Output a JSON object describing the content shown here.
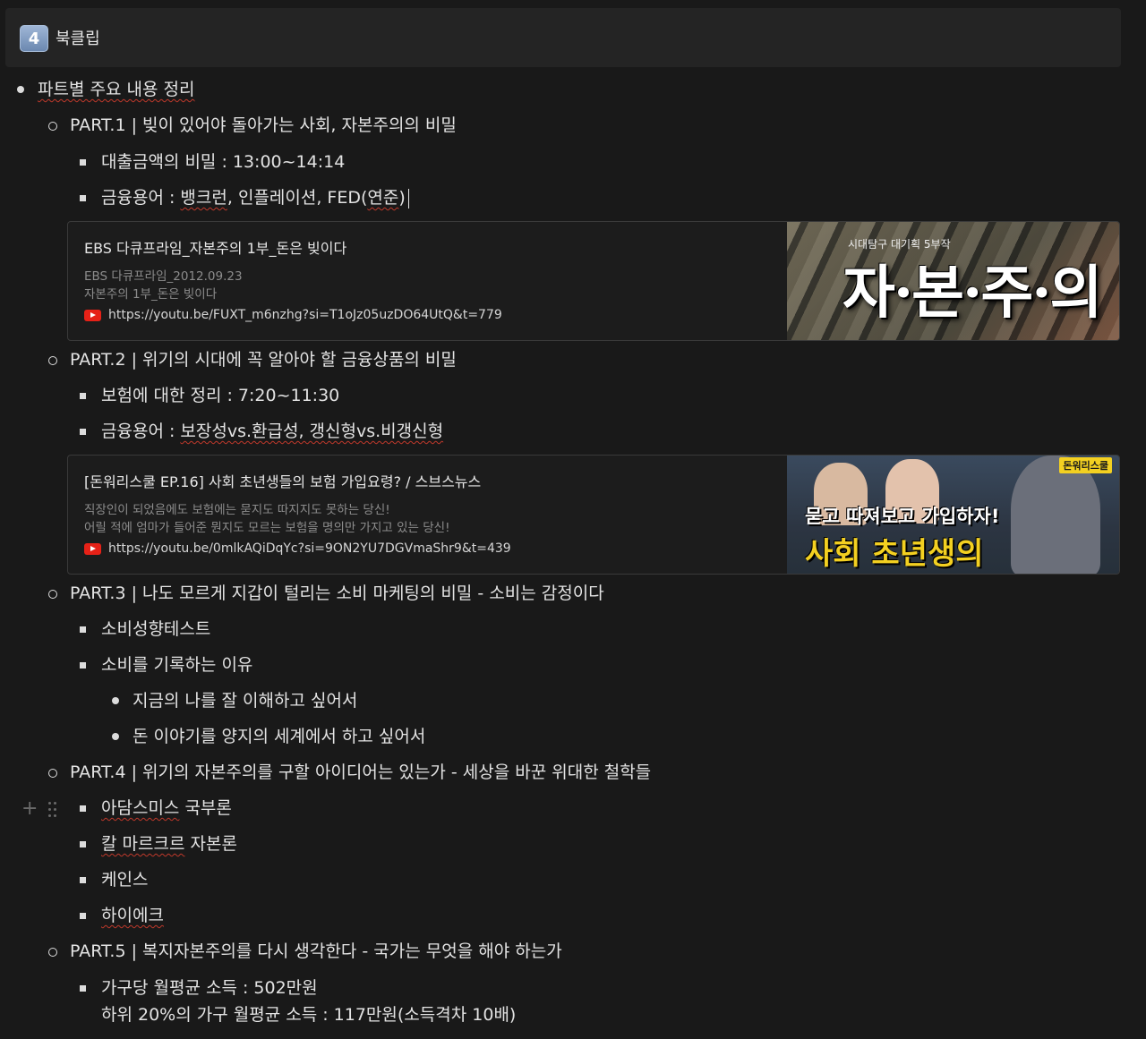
{
  "callout": {
    "badge": "4",
    "title": "북클립"
  },
  "lines": {
    "l1": "파트별 주요 내용 정리",
    "p1": "PART.1 | 빚이 있어야 돌아가는 사회, 자본주의의 비밀",
    "p1a": "대출금액의 비밀 : 13:00~14:14",
    "p1b_prefix": "금융용어 : ",
    "p1b_w1": "뱅크런",
    "p1b_rest": ", 인플레이션, FED(",
    "p1b_w2": "연준",
    "p1b_end": ")",
    "p2": "PART.2 | 위기의 시대에 꼭 알아야 할 금융상품의 비밀",
    "p2a": "보험에 대한 정리 : 7:20~11:30",
    "p2b_prefix": "금융용어 : ",
    "p2b_w": "보장성vs.환급성, 갱신형vs.비갱신형",
    "p3": "PART.3 | 나도 모르게 지갑이 털리는 소비 마케팅의 비밀 - 소비는 감정이다",
    "p3a": "소비성향테스트",
    "p3b": "소비를 기록하는 이유",
    "p3b1": "지금의 나를 잘 이해하고 싶어서",
    "p3b2": "돈 이야기를 양지의 세계에서 하고 싶어서",
    "p4": "PART.4 | 위기의 자본주의를 구할 아이디어는 있는가 - 세상을 바꾼 위대한 철학들",
    "p4a_w": "아담스미스",
    "p4a_rest": " 국부론",
    "p4b_w": "칼 마르크르",
    "p4b_rest": " 자본론",
    "p4c": "케인스",
    "p4d": "하이에크",
    "p5": "PART.5 | 복지자본주의를 다시 생각한다 - 국가는 무엇을 해야 하는가",
    "p5a": "가구당 월평균 소득 : 502만원",
    "p5b": "하위 20%의 가구 월평균 소득 : 117만원(소득격차 10배)"
  },
  "bookmark1": {
    "title": "EBS 다큐프라임_자본주의 1부_돈은 빚이다",
    "desc1": "EBS 다큐프라임_2012.09.23",
    "desc2": "자본주의 1부_돈은 빚이다",
    "url": "https://youtu.be/FUXT_m6nzhg?si=T1oJz05uzDO64UtQ&t=779",
    "thumb_small": "시대탐구 대기획 5부작",
    "thumb_big": "자·본·주·의"
  },
  "bookmark2": {
    "title": "[돈워리스쿨 EP.16] 사회 초년생들의 보험 가입요령? / 스브스뉴스",
    "desc1": "직장인이 되었음에도 보험에는 묻지도 따지지도 못하는 당신!",
    "desc2": "어릴 적에 엄마가 들어준 뭔지도 모르는 보험을 명의만 가지고 있는 당신!",
    "url": "https://youtu.be/0mlkAQiDqYc?si=9ON2YU7DGVmaShr9&t=439",
    "thumb_badge": "돈워리스쿨",
    "thumb_mid": "묻고 따져보고 가입하자!",
    "thumb_yel": "사회 초년생의"
  }
}
